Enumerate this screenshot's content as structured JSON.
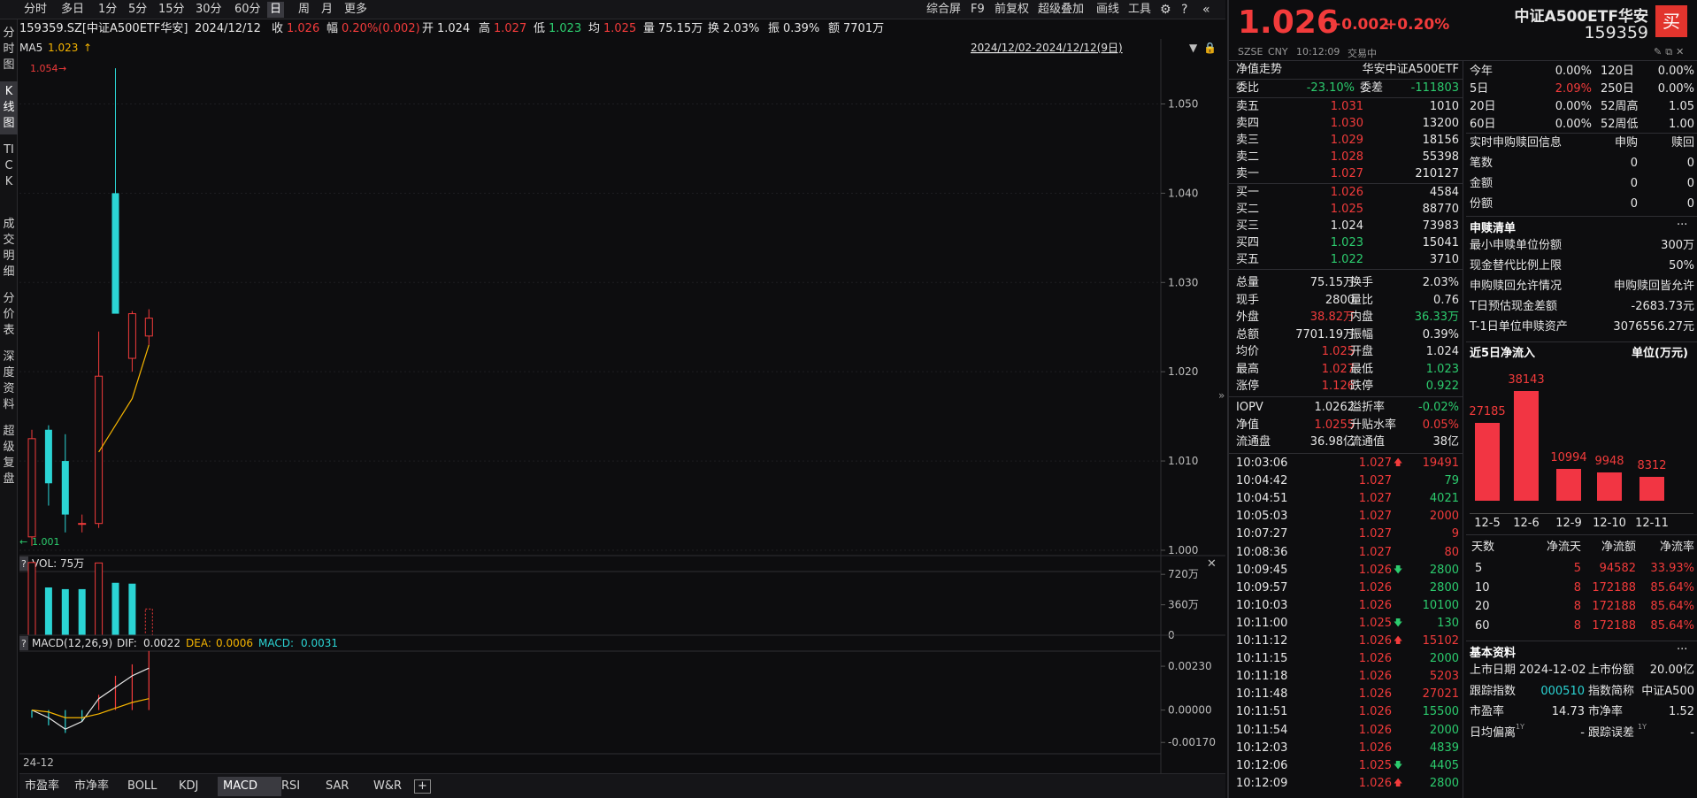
{
  "toolbar": {
    "left": [
      "分时",
      "多日",
      "1分",
      "5分",
      "15分",
      "30分",
      "60分",
      "日",
      "周",
      "月",
      "更多"
    ],
    "right": [
      "综合屏",
      "F9",
      "前复权",
      "超级叠加",
      "画线",
      "工具"
    ],
    "active": "日"
  },
  "sidenav": [
    "分时图",
    "K线图",
    "TICK",
    "成交明细",
    "分价表",
    "深度资料",
    "超级复盘"
  ],
  "infobar": {
    "code": "159359.SZ[中证A500ETF华安]",
    "date": "2024/12/12",
    "close_label": "收",
    "close": "1.026",
    "change_label": "幅",
    "change": "0.20%(0.002)",
    "open_label": "开",
    "open": "1.024",
    "high_label": "高",
    "high": "1.027",
    "low_label": "低",
    "low": "1.023",
    "avg_label": "均",
    "avg": "1.025",
    "vol_label": "量",
    "vol": "75.15万",
    "turn_label": "换",
    "turn": "2.03%",
    "amp_label": "振",
    "amp": "0.39%",
    "amt_label": "额",
    "amt": "7701万"
  },
  "ma": {
    "label": "MA5",
    "value": "1.023",
    "arrow": "↑"
  },
  "range": "2024/12/02-2024/12/12(9日)",
  "kline": {
    "max_label": "1.054",
    "min_label": "1.001",
    "arrow_max": "→",
    "arrow_min": "←",
    "yticks": [
      "1.050",
      "1.040",
      "1.030",
      "1.020",
      "1.010",
      "1.000"
    ],
    "candles": [
      {
        "o": 1.0015,
        "h": 1.0135,
        "l": 1.0005,
        "c": 1.0125,
        "up": true
      },
      {
        "o": 1.0135,
        "h": 1.014,
        "l": 1.005,
        "c": 1.0075,
        "up": false
      },
      {
        "o": 1.01,
        "h": 1.013,
        "l": 1.002,
        "c": 1.004,
        "up": false
      },
      {
        "o": 1.003,
        "h": 1.004,
        "l": 1.002,
        "c": 1.003,
        "up": true
      },
      {
        "o": 1.003,
        "h": 1.0245,
        "l": 1.0025,
        "c": 1.0195,
        "up": true
      },
      {
        "o": 1.04,
        "h": 1.054,
        "l": 1.027,
        "c": 1.0265,
        "up": false
      },
      {
        "o": 1.0215,
        "h": 1.0268,
        "l": 1.02,
        "c": 1.0265,
        "up": true
      },
      {
        "o": 1.024,
        "h": 1.027,
        "l": 1.023,
        "c": 1.026,
        "up": true
      }
    ],
    "ma5": [
      null,
      null,
      null,
      null,
      1.011,
      1.014,
      1.017,
      1.023
    ]
  },
  "vol": {
    "label": "VOL: 75万",
    "yticks": [
      "720万",
      "360万",
      "0"
    ],
    "max": 900,
    "bars": [
      {
        "v": 860,
        "up": true
      },
      {
        "v": 565,
        "up": false
      },
      {
        "v": 545,
        "up": false
      },
      {
        "v": 545,
        "up": false
      },
      {
        "v": 855,
        "up": true
      },
      {
        "v": 620,
        "up": false
      },
      {
        "v": 610,
        "up": false
      },
      {
        "v": 310,
        "up": true,
        "dashed": true
      }
    ]
  },
  "macd": {
    "label": "MACD(12,26,9)",
    "dif_label": "DIF:",
    "dif": "0.0022",
    "dea_label": "DEA:",
    "dea": "0.0006",
    "macd_label": "MACD:",
    "macd": "0.0031",
    "yticks": [
      "0.00230",
      "0.00000",
      "-0.00170"
    ],
    "hist": [
      -0.0004,
      -0.0008,
      -0.0012,
      -0.0006,
      0.0008,
      0.0018,
      0.0024,
      0.0031
    ],
    "dif_line": [
      0.0,
      -0.0004,
      -0.001,
      -0.0006,
      0.0006,
      0.0012,
      0.0018,
      0.0022
    ],
    "dea_line": [
      0.0,
      -0.0001,
      -0.0004,
      -0.0004,
      -0.0002,
      0.0001,
      0.0004,
      0.0006
    ]
  },
  "xlabel": "24-12",
  "bottom_tabs": [
    "市盈率",
    "市净率",
    "BOLL",
    "KDJ",
    "MACD",
    "RSI",
    "SAR",
    "W&R",
    "+"
  ],
  "bottom_active": "MACD",
  "quote": {
    "price": "1.026",
    "change": "+0.002",
    "pct": "+0.20%",
    "name": "中证A500ETF华安",
    "code": "159359",
    "buy": "买",
    "exch": "SZSE",
    "ccy": "CNY",
    "time": "10:12:09",
    "status": "交易中"
  },
  "nav": {
    "label": "净值走势",
    "fund": "华安中证A500ETF"
  },
  "weibi": {
    "label": "委比",
    "value": "-23.10%",
    "diff_label": "委差",
    "diff": "-111803"
  },
  "asks": [
    {
      "l": "卖五",
      "p": "1.031",
      "v": "1010"
    },
    {
      "l": "卖四",
      "p": "1.030",
      "v": "13200"
    },
    {
      "l": "卖三",
      "p": "1.029",
      "v": "18156"
    },
    {
      "l": "卖二",
      "p": "1.028",
      "v": "55398"
    },
    {
      "l": "卖一",
      "p": "1.027",
      "v": "210127"
    }
  ],
  "bids": [
    {
      "l": "买一",
      "p": "1.026",
      "v": "4584"
    },
    {
      "l": "买二",
      "p": "1.025",
      "v": "88770"
    },
    {
      "l": "买三",
      "p": "1.024",
      "v": "73983"
    },
    {
      "l": "买四",
      "p": "1.023",
      "v": "15041"
    },
    {
      "l": "买五",
      "p": "1.022",
      "v": "3710"
    }
  ],
  "stats": [
    {
      "l1": "总量",
      "v1": "75.15万",
      "c1": "wt",
      "l2": "换手",
      "v2": "2.03%",
      "c2": "wt"
    },
    {
      "l1": "现手",
      "v1": "2800",
      "c1": "wt",
      "l2": "量比",
      "v2": "0.76",
      "c2": "wt"
    },
    {
      "l1": "外盘",
      "v1": "38.82万",
      "c1": "up",
      "l2": "内盘",
      "v2": "36.33万",
      "c2": "dn"
    },
    {
      "l1": "总额",
      "v1": "7701.19万",
      "c1": "wt",
      "l2": "振幅",
      "v2": "0.39%",
      "c2": "wt"
    },
    {
      "l1": "均价",
      "v1": "1.025",
      "c1": "up",
      "l2": "开盘",
      "v2": "1.024",
      "c2": "wt"
    },
    {
      "l1": "最高",
      "v1": "1.027",
      "c1": "up",
      "l2": "最低",
      "v2": "1.023",
      "c2": "dn"
    },
    {
      "l1": "涨停",
      "v1": "1.126",
      "c1": "up",
      "l2": "跌停",
      "v2": "0.922",
      "c2": "dn"
    }
  ],
  "stats2": [
    {
      "l1": "IOPV",
      "v1": "1.0262",
      "c1": "wt",
      "l2": "溢折率",
      "v2": "-0.02%",
      "c2": "dn"
    },
    {
      "l1": "净值",
      "v1": "1.0255",
      "c1": "up",
      "l2": "升贴水率",
      "v2": "0.05%",
      "c2": "up"
    },
    {
      "l1": "流通盘",
      "v1": "36.98亿",
      "c1": "wt",
      "l2": "流通值",
      "v2": "38亿",
      "c2": "wt"
    }
  ],
  "ticks": [
    {
      "t": "10:03:06",
      "p": "1.027",
      "a": "up",
      "v": "19491",
      "vc": "up"
    },
    {
      "t": "10:04:42",
      "p": "1.027",
      "a": "",
      "v": "79",
      "vc": "dn"
    },
    {
      "t": "10:04:51",
      "p": "1.027",
      "a": "",
      "v": "4021",
      "vc": "dn"
    },
    {
      "t": "10:05:03",
      "p": "1.027",
      "a": "",
      "v": "2000",
      "vc": "up"
    },
    {
      "t": "10:07:27",
      "p": "1.027",
      "a": "",
      "v": "9",
      "vc": "up"
    },
    {
      "t": "10:08:36",
      "p": "1.027",
      "a": "",
      "v": "80",
      "vc": "up"
    },
    {
      "t": "10:09:45",
      "p": "1.026",
      "a": "dn",
      "v": "2800",
      "vc": "dn"
    },
    {
      "t": "10:09:57",
      "p": "1.026",
      "a": "",
      "v": "2800",
      "vc": "dn"
    },
    {
      "t": "10:10:03",
      "p": "1.026",
      "a": "",
      "v": "10100",
      "vc": "dn"
    },
    {
      "t": "10:11:00",
      "p": "1.025",
      "a": "dn",
      "v": "130",
      "vc": "dn"
    },
    {
      "t": "10:11:12",
      "p": "1.026",
      "a": "up",
      "v": "15102",
      "vc": "up"
    },
    {
      "t": "10:11:15",
      "p": "1.026",
      "a": "",
      "v": "2000",
      "vc": "dn"
    },
    {
      "t": "10:11:18",
      "p": "1.026",
      "a": "",
      "v": "5203",
      "vc": "up"
    },
    {
      "t": "10:11:48",
      "p": "1.026",
      "a": "",
      "v": "27021",
      "vc": "up"
    },
    {
      "t": "10:11:51",
      "p": "1.026",
      "a": "",
      "v": "15500",
      "vc": "dn"
    },
    {
      "t": "10:11:54",
      "p": "1.026",
      "a": "",
      "v": "2000",
      "vc": "dn"
    },
    {
      "t": "10:12:03",
      "p": "1.026",
      "a": "",
      "v": "4839",
      "vc": "dn"
    },
    {
      "t": "10:12:06",
      "p": "1.025",
      "a": "dn",
      "v": "4405",
      "vc": "dn"
    },
    {
      "t": "10:12:09",
      "p": "1.026",
      "a": "up",
      "v": "2800",
      "vc": "dn"
    }
  ],
  "perf": [
    {
      "l1": "今年",
      "v1": "0.00%",
      "c1": "wt",
      "l2": "120日",
      "v2": "0.00%"
    },
    {
      "l1": "5日",
      "v1": "2.09%",
      "c1": "up",
      "l2": "250日",
      "v2": "0.00%"
    },
    {
      "l1": "20日",
      "v1": "0.00%",
      "c1": "wt",
      "l2": "52周高",
      "v2": "1.05"
    },
    {
      "l1": "60日",
      "v1": "0.00%",
      "c1": "wt",
      "l2": "52周低",
      "v2": "1.00"
    }
  ],
  "redeem": {
    "title": "实时申购赎回信息",
    "col1": "申购",
    "col2": "赎回",
    "rows": [
      {
        "l": "笔数",
        "a": "0",
        "b": "0"
      },
      {
        "l": "金额",
        "a": "0",
        "b": "0"
      },
      {
        "l": "份额",
        "a": "0",
        "b": "0"
      }
    ]
  },
  "list": {
    "title": "申赎清单",
    "more": "···",
    "rows": [
      {
        "l": "最小申赎单位份额",
        "v": "300万"
      },
      {
        "l": "现金替代比例上限",
        "v": "50%"
      },
      {
        "l": "申购赎回允许情况",
        "v": "申购赎回皆允许"
      },
      {
        "l": "T日预估现金差额",
        "v": "-2683.73元"
      },
      {
        "l": "T-1日单位申赎资产",
        "v": "3076556.27元"
      }
    ]
  },
  "chart_data": {
    "type": "bar",
    "title": "近5日净流入",
    "unit": "单位(万元)",
    "categories": [
      "12-5",
      "12-6",
      "12-9",
      "12-10",
      "12-11"
    ],
    "values": [
      27185,
      38143,
      10994,
      9948,
      8312
    ],
    "ylim": [
      0,
      45000
    ]
  },
  "flow": {
    "h": [
      "天数",
      "净流天",
      "净流额",
      "净流率"
    ],
    "rows": [
      {
        "d": "5",
        "n": "5",
        "a": "94582",
        "r": "33.93%"
      },
      {
        "d": "10",
        "n": "8",
        "a": "172188",
        "r": "85.64%"
      },
      {
        "d": "20",
        "n": "8",
        "a": "172188",
        "r": "85.64%"
      },
      {
        "d": "60",
        "n": "8",
        "a": "172188",
        "r": "85.64%"
      }
    ]
  },
  "basic": {
    "title": "基本资料",
    "more": "···",
    "rows": [
      {
        "l1": "上市日期",
        "v1": "2024-12-02",
        "c1": "wt",
        "l2": "上市份额",
        "v2": "20.00亿",
        "c2": "wt"
      },
      {
        "l1": "跟踪指数",
        "v1": "000510",
        "c1": "cy",
        "l2": "指数简称",
        "v2": "中证A500",
        "c2": "wt"
      },
      {
        "l1": "市盈率",
        "v1": "14.73",
        "c1": "wt",
        "l2": "市净率",
        "v2": "1.52",
        "c2": "wt"
      },
      {
        "l1": "日均偏离",
        "s1": "1Y",
        "v1": "-",
        "c1": "wt",
        "l2": "跟踪误差",
        "s2": "1Y",
        "v2": "-",
        "c2": "wt"
      }
    ]
  }
}
